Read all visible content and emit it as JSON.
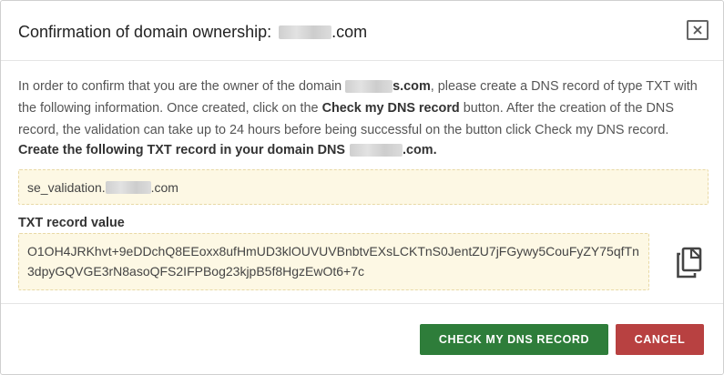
{
  "dialog": {
    "title_prefix": "Confirmation of domain ownership:",
    "title_suffix": ".com",
    "close_icon": "close-icon"
  },
  "intro": {
    "part1": "In order to confirm that you are the owner of the domain ",
    "domain_suffix": "s.com",
    "part2": ", please create a DNS record of type TXT with the following information. Once created, click on the ",
    "button_ref": "Check my DNS record",
    "part3": " button. After the creation of the DNS record, the validation can take up to 24 hours before being successful on the button click Check my DNS record."
  },
  "instruction": {
    "prefix": "Create the following TXT record in your domain DNS",
    "suffix": ".com."
  },
  "record": {
    "prefix": "se_validation.",
    "suffix": ".com"
  },
  "txt_value": {
    "label": "TXT record value",
    "value": "O1OH4JRKhvt+9eDDchQ8EEoxx8ufHmUD3klOUVUVBnbtvEXsLCKTnS0JentZU7jFGywy5CouFyZY75qfTn3dpyGQVGE3rN8asoQFS2IFPBog23kjpB5f8HgzEwOt6+7c",
    "copy_icon": "copy-icon"
  },
  "actions": {
    "check_label": "CHECK MY DNS RECORD",
    "cancel_label": "CANCEL"
  },
  "colors": {
    "check_button": "#2e7d3a",
    "cancel_button": "#b84141",
    "record_box_bg": "#fdf8e4"
  }
}
